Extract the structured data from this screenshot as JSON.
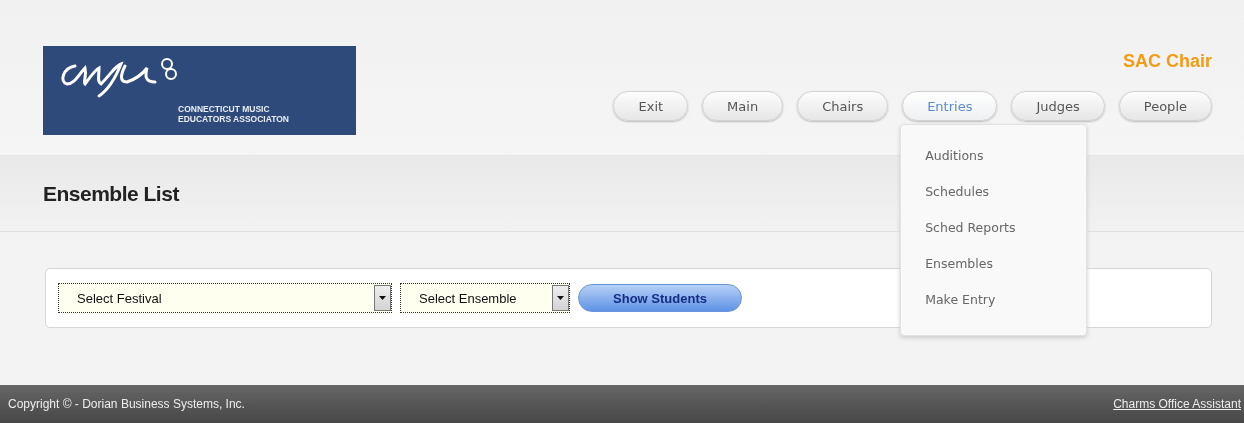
{
  "logo": {
    "line1": "CONNECTICUT MUSIC",
    "line2": "EDUCATORS ASSOCIATON"
  },
  "user_role": "SAC Chair",
  "nav": [
    {
      "label": "Exit",
      "selected": false
    },
    {
      "label": "Main",
      "selected": false
    },
    {
      "label": "Chairs",
      "selected": false
    },
    {
      "label": "Entries",
      "selected": true,
      "menu": [
        "Auditions",
        "Schedules",
        "Sched Reports",
        "Ensembles",
        "Make Entry"
      ]
    },
    {
      "label": "Judges",
      "selected": false
    },
    {
      "label": "People",
      "selected": false
    }
  ],
  "page_title": "Ensemble List",
  "filters": {
    "festival": "Select Festival",
    "ensemble": "Select Ensemble",
    "button": "Show Students"
  },
  "footer": {
    "copyright": "Copyright © - Dorian Business Systems, Inc.",
    "link": "Charms Office Assistant"
  }
}
